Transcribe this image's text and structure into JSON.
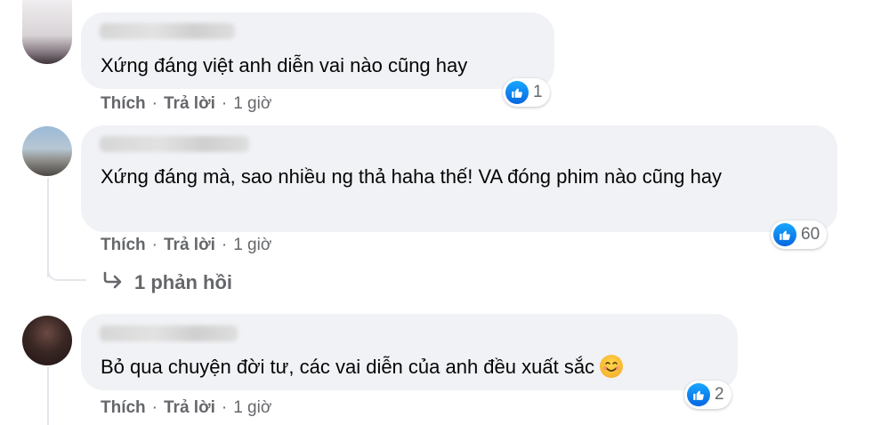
{
  "comments": [
    {
      "text": "Xứng đáng việt anh diễn vai nào cũng hay",
      "like_label": "Thích",
      "reply_label": "Trả lời",
      "time": "1 giờ",
      "reaction_count": "1"
    },
    {
      "text": "Xứng đáng mà, sao nhiều ng thả haha thế! VA đóng phim nào cũng hay",
      "like_label": "Thích",
      "reply_label": "Trả lời",
      "time": "1 giờ",
      "reaction_count": "60",
      "replies_link": "1 phản hồi"
    },
    {
      "text": "Bỏ qua chuyện đời tư, các vai diễn của anh đều xuất sắc",
      "like_label": "Thích",
      "reply_label": "Trả lời",
      "time": "1 giờ",
      "reaction_count": "2"
    }
  ],
  "separator": "·",
  "icons": {
    "reaction": "like-icon",
    "reply": "reply-arrow-icon",
    "emoji": "smiling-face-icon"
  },
  "colors": {
    "bubble": "#f0f2f5",
    "like_blue": "#1877f2",
    "meta_text": "#65676b"
  }
}
